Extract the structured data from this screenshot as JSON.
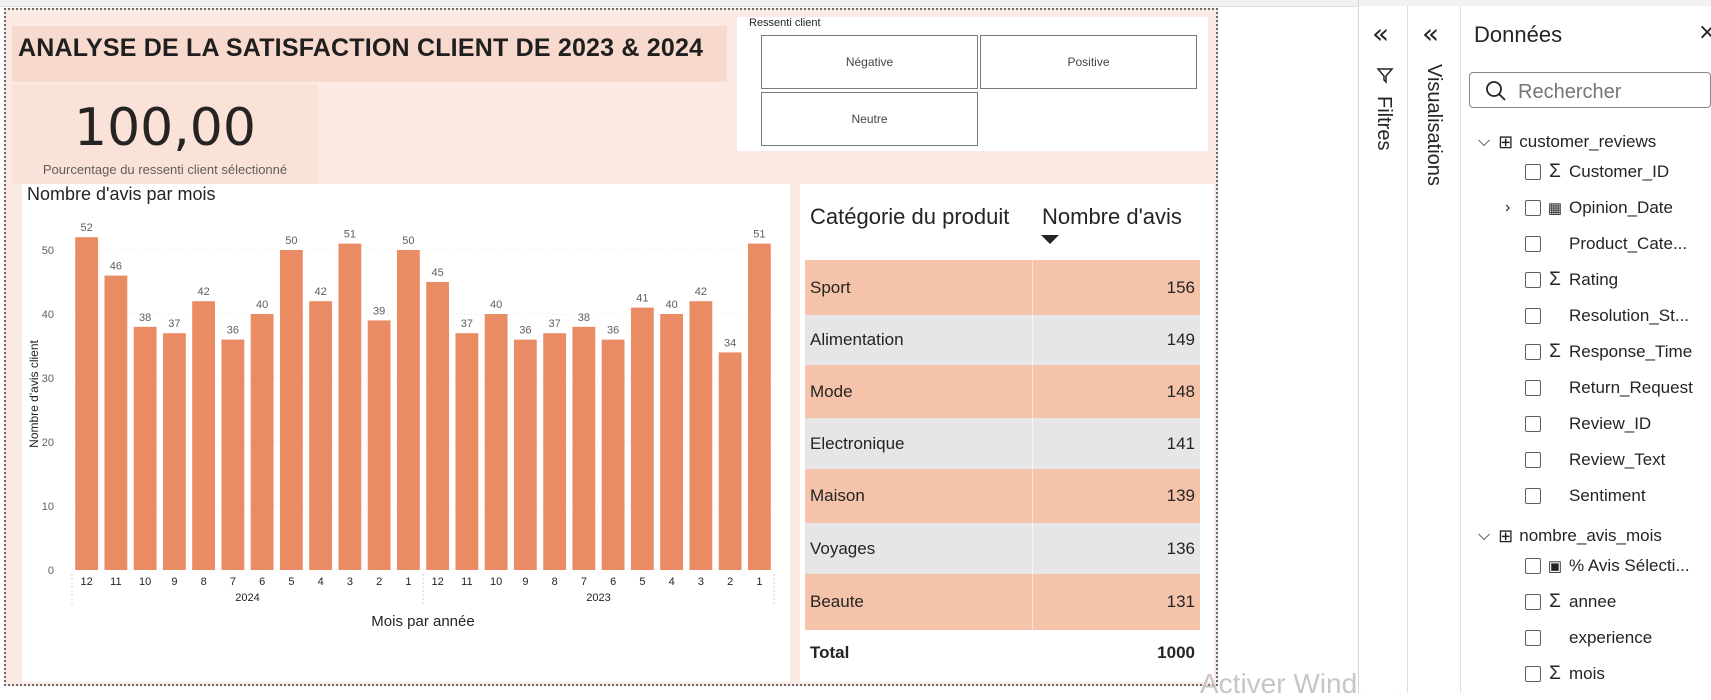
{
  "report": {
    "title": "ANALYSE DE LA SATISFACTION CLIENT DE 2023 & 2024",
    "kpi": {
      "value": "100,00",
      "label": "Pourcentage du ressenti client sélectionné"
    },
    "slicer": {
      "title": "Ressenti client",
      "options": [
        "Négative",
        "Positive",
        "Neutre"
      ]
    },
    "table": {
      "headers": [
        "Catégorie du produit",
        "Nombre d'avis"
      ],
      "rows": [
        {
          "category": "Sport",
          "count": "156"
        },
        {
          "category": "Alimentation",
          "count": "149"
        },
        {
          "category": "Mode",
          "count": "148"
        },
        {
          "category": "Electronique",
          "count": "141"
        },
        {
          "category": "Maison",
          "count": "139"
        },
        {
          "category": "Voyages",
          "count": "136"
        },
        {
          "category": "Beaute",
          "count": "131"
        }
      ],
      "total_label": "Total",
      "total_value": "1000",
      "row_colors": [
        "#f4c3aa",
        "#e6e6e6"
      ]
    },
    "watermark": "Activer Windows"
  },
  "chart_data": {
    "type": "bar",
    "title": "Nombre d'avis par mois",
    "xlabel": "Mois par année",
    "ylabel": "Nombre d'avis client",
    "ylim": [
      0,
      55
    ],
    "yticks": [
      0,
      10,
      20,
      30,
      40,
      50
    ],
    "categories": [
      "12",
      "11",
      "10",
      "9",
      "8",
      "7",
      "6",
      "5",
      "4",
      "3",
      "2",
      "1",
      "12",
      "11",
      "10",
      "9",
      "8",
      "7",
      "6",
      "5",
      "4",
      "3",
      "2",
      "1"
    ],
    "groups": [
      {
        "label": "2024",
        "count": 12
      },
      {
        "label": "2023",
        "count": 12
      }
    ],
    "values": [
      52,
      46,
      38,
      37,
      42,
      36,
      40,
      50,
      42,
      51,
      39,
      50,
      45,
      37,
      40,
      36,
      37,
      38,
      36,
      41,
      40,
      42,
      34,
      51
    ],
    "bar_color": "#e98c64",
    "grid": true,
    "data_labels": true
  },
  "panes": {
    "filters_label": "Filtres",
    "visualisations_label": "Visualisations",
    "data": {
      "title": "Données",
      "search_placeholder": "Rechercher",
      "tables": [
        {
          "name": "customer_reviews",
          "fields": [
            {
              "name": "Customer_ID",
              "icon": "sigma-icon"
            },
            {
              "name": "Opinion_Date",
              "icon": "calendar-icon",
              "expandable": true
            },
            {
              "name": "Product_Cate...",
              "icon": ""
            },
            {
              "name": "Rating",
              "icon": "sigma-icon"
            },
            {
              "name": "Resolution_St...",
              "icon": ""
            },
            {
              "name": "Response_Time",
              "icon": "sigma-icon"
            },
            {
              "name": "Return_Request",
              "icon": ""
            },
            {
              "name": "Review_ID",
              "icon": ""
            },
            {
              "name": "Review_Text",
              "icon": ""
            },
            {
              "name": "Sentiment",
              "icon": ""
            }
          ]
        },
        {
          "name": "nombre_avis_mois",
          "fields": [
            {
              "name": "% Avis Sélecti...",
              "icon": "calculator-icon"
            },
            {
              "name": "annee",
              "icon": "sigma-icon"
            },
            {
              "name": "experience",
              "icon": ""
            },
            {
              "name": "mois",
              "icon": "sigma-icon"
            }
          ]
        }
      ]
    }
  }
}
